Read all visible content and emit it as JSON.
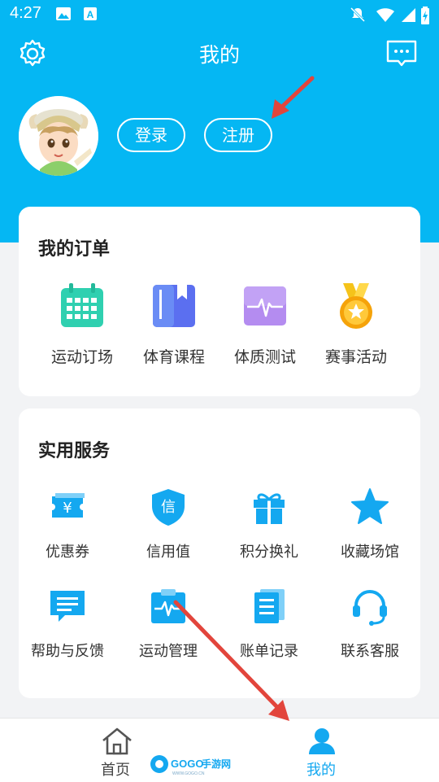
{
  "status_bar": {
    "time": "4:27"
  },
  "header": {
    "title": "我的",
    "settings_icon": "gear-icon",
    "message_icon": "chat-bubble-icon"
  },
  "auth": {
    "login_label": "登录",
    "register_label": "注册"
  },
  "orders": {
    "title": "我的订单",
    "items": [
      {
        "label": "运动订场",
        "icon": "calendar-icon",
        "color": "#2fd0b0"
      },
      {
        "label": "体育课程",
        "icon": "book-icon",
        "color": "#5b6ff0"
      },
      {
        "label": "体质测试",
        "icon": "pulse-monitor-icon",
        "color": "#b48cf0"
      },
      {
        "label": "赛事活动",
        "icon": "medal-icon",
        "color": "#f5b40a"
      }
    ]
  },
  "services": {
    "title": "实用服务",
    "items": [
      {
        "label": "优惠券",
        "icon": "coupon-icon",
        "glyph": "¥"
      },
      {
        "label": "信用值",
        "icon": "credit-shield-icon",
        "glyph": "信"
      },
      {
        "label": "积分换礼",
        "icon": "gift-icon"
      },
      {
        "label": "收藏场馆",
        "icon": "star-icon"
      },
      {
        "label": "帮助与反馈",
        "icon": "feedback-icon"
      },
      {
        "label": "运动管理",
        "icon": "clipboard-pulse-icon"
      },
      {
        "label": "账单记录",
        "icon": "document-icon"
      },
      {
        "label": "联系客服",
        "icon": "headset-icon"
      }
    ],
    "icon_color": "#14a8f0"
  },
  "bottom_nav": {
    "items": [
      {
        "label": "首页",
        "icon": "home-icon",
        "active": false
      },
      {
        "label": "我的",
        "icon": "user-icon",
        "active": true
      }
    ],
    "active_color": "#14a8f0",
    "watermark": "GOGO手游网 www.gogo.cn"
  }
}
